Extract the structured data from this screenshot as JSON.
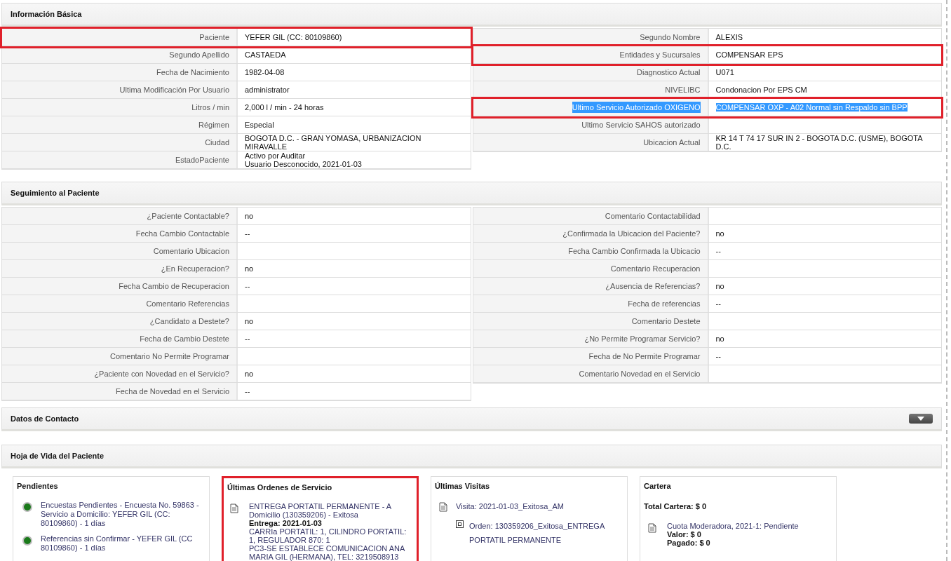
{
  "basic": {
    "title": "Información Básica",
    "left": [
      {
        "label": "Paciente",
        "value": "YEFER GIL (CC: 80109860)",
        "marked": true,
        "selected": false
      },
      {
        "label": "Segundo Apellido",
        "value": " CASTAEDA",
        "marked": false,
        "selected": false
      },
      {
        "label": "Fecha de Nacimiento",
        "value": "1982-04-08",
        "marked": false,
        "selected": false
      },
      {
        "label": "Ultima Modificación Por Usuario",
        "value": " administrator",
        "marked": false,
        "selected": false
      },
      {
        "label": "Litros / min",
        "value": " 2,000 l / min - 24 horas",
        "marked": false,
        "selected": false
      },
      {
        "label": "Régimen",
        "value": " Especial",
        "marked": false,
        "selected": false
      },
      {
        "label": "Ciudad",
        "value": " BOGOTA D.C. - GRAN YOMASA, URBANIZACION MIRAVALLE",
        "marked": false,
        "selected": false
      },
      {
        "label": "EstadoPaciente",
        "value": " Activo por Auditar\n Usuario Desconocido, 2021-01-03",
        "marked": false,
        "selected": false
      }
    ],
    "right": [
      {
        "label": "Segundo Nombre",
        "value": " ALEXIS",
        "marked": false,
        "selected": false
      },
      {
        "label": "Entidades y Sucursales",
        "value": "COMPENSAR EPS",
        "marked": true,
        "selected": false
      },
      {
        "label": "Diagnostico Actual",
        "value": "U071",
        "marked": false,
        "selected": false
      },
      {
        "label": "NIVELIBC",
        "value": " Condonacion Por EPS CM",
        "marked": false,
        "selected": false
      },
      {
        "label": "Ultimo Servicio Autorizado OXIGENO",
        "value": "COMPENSAR OXP - A02 Normal sin Respaldo sin BPP",
        "marked": true,
        "selected": true
      },
      {
        "label": "Ultimo Servicio SAHOS autorizado",
        "marked": false,
        "selected": false
      },
      {
        "label": "Ubicacion Actual",
        "value": "KR 14 T 74 17 SUR IN 2 - BOGOTA D.C. (USME), BOGOTA D.C.",
        "marked": false,
        "selected": false
      }
    ]
  },
  "tracking": {
    "title": "Seguimiento al Paciente",
    "left": [
      {
        "label": "¿Paciente Contactable?",
        "value": "no"
      },
      {
        "label": "Fecha Cambio Contactable",
        "value": "--"
      },
      {
        "label": "Comentario Ubicacion"
      },
      {
        "label": "¿En Recuperacion?",
        "value": "no"
      },
      {
        "label": "Fecha Cambio de Recuperacion",
        "value": "--"
      },
      {
        "label": "Comentario Referencias"
      },
      {
        "label": "¿Candidato a Destete?",
        "value": "no"
      },
      {
        "label": "Fecha de Cambio Destete",
        "value": "--"
      },
      {
        "label": "Comentario No Permite Programar"
      },
      {
        "label": "¿Paciente con Novedad en el Servicio?",
        "value": "no"
      },
      {
        "label": "Fecha de Novedad en el Servicio",
        "value": "--"
      }
    ],
    "right": [
      {
        "label": "Comentario Contactabilidad"
      },
      {
        "label": "¿Confirmada la Ubicacion del Paciente?",
        "value": "no"
      },
      {
        "label": "Fecha Cambio Confirmada la Ubicacio",
        "value": "--"
      },
      {
        "label": "Comentario Recuperacion"
      },
      {
        "label": "¿Ausencia de Referencias?",
        "value": "no"
      },
      {
        "label": "Fecha de referencias",
        "value": "--"
      },
      {
        "label": "Comentario Destete"
      },
      {
        "label": "¿No Permite Programar Servicio?",
        "value": "no"
      },
      {
        "label": "Fecha de No Permite Programar",
        "value": "--"
      },
      {
        "label": "Comentario Novedad en el Servicio"
      }
    ]
  },
  "contact": {
    "title": "Datos de Contacto",
    "expanded": false
  },
  "history": {
    "title": "Hoja de Vida del Paciente",
    "pending": {
      "title": "Pendientes",
      "marked": false,
      "items": [
        {
          "text": "Encuestas Pendientes - Encuesta No. 59863 - Servicio a Domicilio: YEFER GIL (CC: 80109860) - 1 días",
          "color": "#1a7a1a"
        },
        {
          "text": "Referencias sin Confirmar - YEFER GIL (CC 80109860) - 1 días",
          "color": "#1a7a1a"
        }
      ]
    },
    "orders": {
      "title": "Últimas Ordenes de Servicio",
      "marked": true,
      "items": [
        {
          "title": "ENTREGA PORTATIL PERMANENTE - A Domicilio (130359206) - Exitosa",
          "delivery": "Entrega: 2021-01-03",
          "details": "CARRIa PORTATIL: 1, CILINDRO PORTATIL: 1, REGULADOR 870: 1\nPC3-SE ESTABLECE COMUNICACION ANA MARIA GIL (HERMANA), TEL: 3219508913"
        }
      ]
    },
    "visits": {
      "title": "Últimas Visitas",
      "marked": false,
      "items": [
        {
          "title": "Visita: 2021-01-03_Exitosa_AM",
          "children": [
            {
              "title": "Orden: 130359206_Exitosa_ENTREGA PORTATIL PERMANENTE"
            }
          ]
        }
      ]
    },
    "wallet": {
      "title": "Cartera",
      "marked": false,
      "total": "Total Cartera: $ 0",
      "items": [
        {
          "title": "Cuota Moderadora, 2021-1: Pendiente",
          "valor": "Valor: $ 0",
          "pagado": "Pagado: $ 0"
        }
      ]
    }
  }
}
